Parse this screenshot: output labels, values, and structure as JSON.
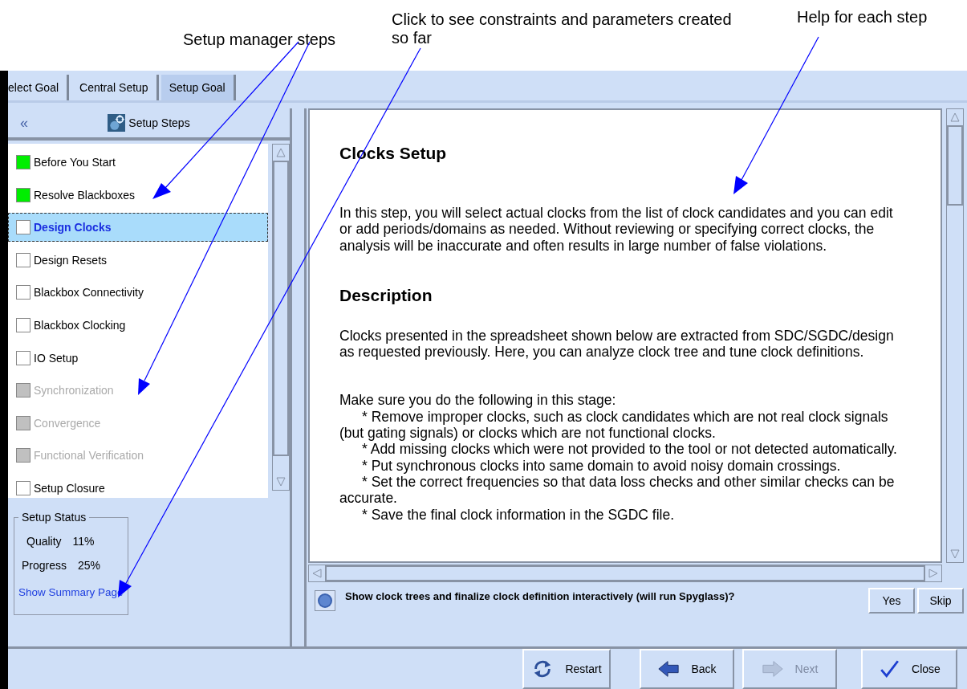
{
  "annotations": [
    {
      "text": "Setup manager steps"
    },
    {
      "text": "Click to see constraints and parameters created so far"
    },
    {
      "text": "Help for each step"
    }
  ],
  "tabs": [
    {
      "label": "elect Goal",
      "selected": false
    },
    {
      "label": "Central Setup",
      "selected": false
    },
    {
      "label": "Setup Goal",
      "selected": true
    }
  ],
  "steps_panel": {
    "collapse": "«",
    "title": "Setup Steps",
    "steps": [
      {
        "label": "Before You Start",
        "done": true,
        "disabled": false,
        "selected": false
      },
      {
        "label": "Resolve Blackboxes",
        "done": true,
        "disabled": false,
        "selected": false
      },
      {
        "label": "Design Clocks",
        "done": false,
        "disabled": false,
        "selected": true
      },
      {
        "label": "Design Resets",
        "done": false,
        "disabled": false,
        "selected": false
      },
      {
        "label": "Blackbox Connectivity",
        "done": false,
        "disabled": false,
        "selected": false
      },
      {
        "label": "Blackbox Clocking",
        "done": false,
        "disabled": false,
        "selected": false
      },
      {
        "label": "IO Setup",
        "done": false,
        "disabled": false,
        "selected": false
      },
      {
        "label": "Synchronization",
        "done": false,
        "disabled": true,
        "selected": false
      },
      {
        "label": "Convergence",
        "done": false,
        "disabled": true,
        "selected": false
      },
      {
        "label": "Functional Verification",
        "done": false,
        "disabled": true,
        "selected": false
      },
      {
        "label": "Setup Closure",
        "done": false,
        "disabled": false,
        "selected": false
      }
    ]
  },
  "setup_status": {
    "legend": "Setup Status",
    "rows": [
      {
        "label": "Quality",
        "value": "11%"
      },
      {
        "label": "Progress",
        "value": "25%"
      }
    ],
    "link": "Show Summary Page"
  },
  "help": {
    "blocks": [
      {
        "kind": "title",
        "text": "Clocks Setup"
      },
      {
        "kind": "paragraph",
        "text": "In this step, you will select actual clocks from the list of clock candidates and you can edit or add  periods/domains as needed. Without reviewing or specifying correct clocks, the analysis will be inaccurate and often results in large number of false violations."
      },
      {
        "kind": "title",
        "text": "Description"
      },
      {
        "kind": "paragraph",
        "text": "Clocks presented in the spreadsheet shown below are extracted from SDC/SGDC/design as requested previously. Here, you can analyze clock tree and tune clock definitions."
      },
      {
        "kind": "lead",
        "text": "Make sure you do the following in this stage:"
      },
      {
        "kind": "bullet",
        "marker": "*",
        "text": "Remove improper clocks, such as clock candidates which are not real clock signals (but gating signals) or clocks which are not functional clocks."
      },
      {
        "kind": "bullet",
        "marker": "*",
        "text": "Add missing clocks which were not provided to the tool or not detected automatically."
      },
      {
        "kind": "bullet",
        "marker": "*",
        "text": "Put synchronous clocks into same domain to avoid noisy domain crossings."
      },
      {
        "kind": "bullet",
        "marker": "*",
        "text": "Set the correct frequencies so that data loss checks and other similar checks can be accurate."
      },
      {
        "kind": "bullet",
        "marker": "*",
        "text": "Save the final clock information in the SGDC file."
      }
    ]
  },
  "question": {
    "text": "Show clock trees and finalize clock definition interactively (will run Spyglass)?",
    "buttons": [
      "Yes",
      "Skip"
    ]
  },
  "footer_buttons": [
    {
      "kind": "restart",
      "label": "Restart",
      "disabled": false
    },
    {
      "kind": "back",
      "label": "Back",
      "disabled": false
    },
    {
      "kind": "next",
      "label": "Next",
      "disabled": true
    },
    {
      "kind": "close",
      "label": "Close",
      "disabled": false
    }
  ]
}
